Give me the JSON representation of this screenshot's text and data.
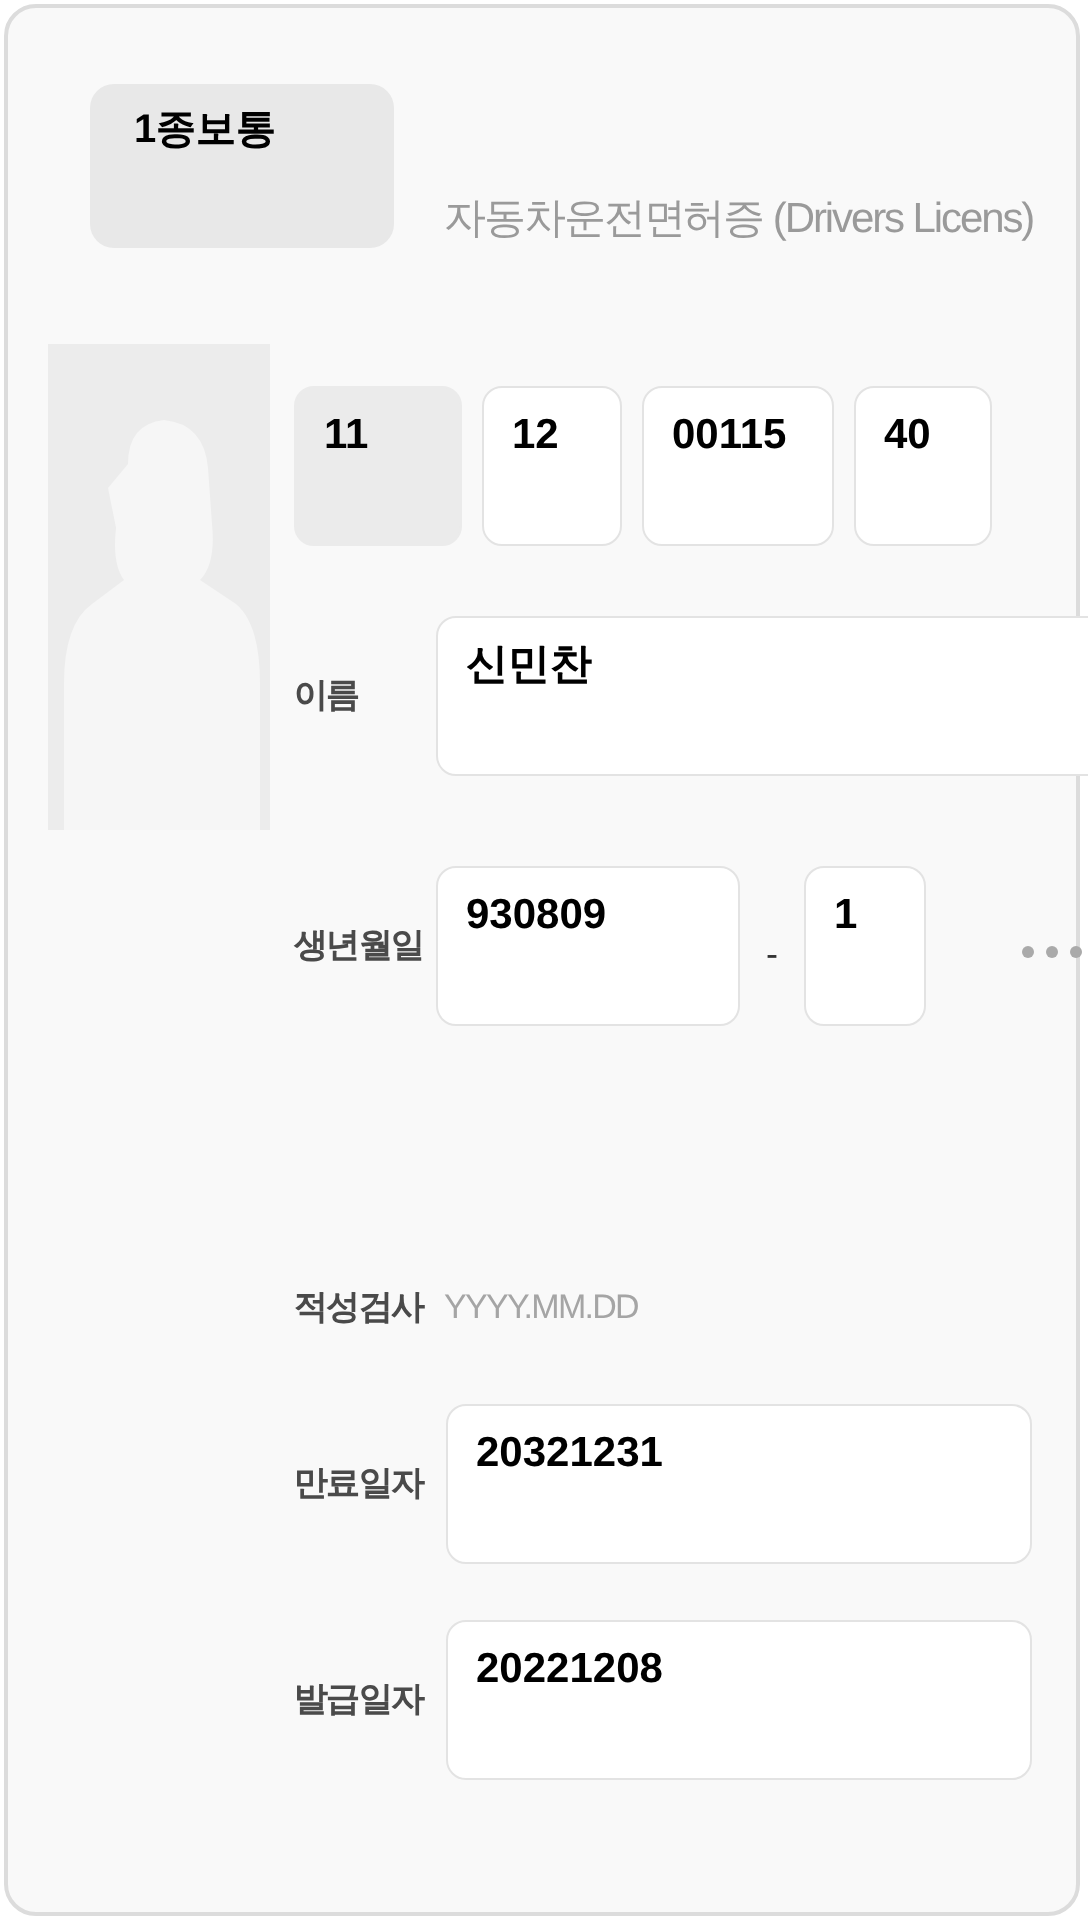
{
  "license_class": "1종보통",
  "title": "자동차운전면허증 (Drivers Licens)",
  "license_number": [
    {
      "value": "11",
      "readonly": true
    },
    {
      "value": "12",
      "readonly": false
    },
    {
      "value": "00115",
      "readonly": false
    },
    {
      "value": "40",
      "readonly": false
    }
  ],
  "name": {
    "label": "이름",
    "value": "신민찬"
  },
  "birth": {
    "label": "생년월일",
    "front": "930809",
    "separator": "-",
    "back": "1"
  },
  "aptitude_test": {
    "label": "적성검사",
    "placeholder": "YYYY.MM.DD"
  },
  "expiry": {
    "label": "만료일자",
    "value": "20321231"
  },
  "issued": {
    "label": "발급일자",
    "value": "20221208"
  }
}
